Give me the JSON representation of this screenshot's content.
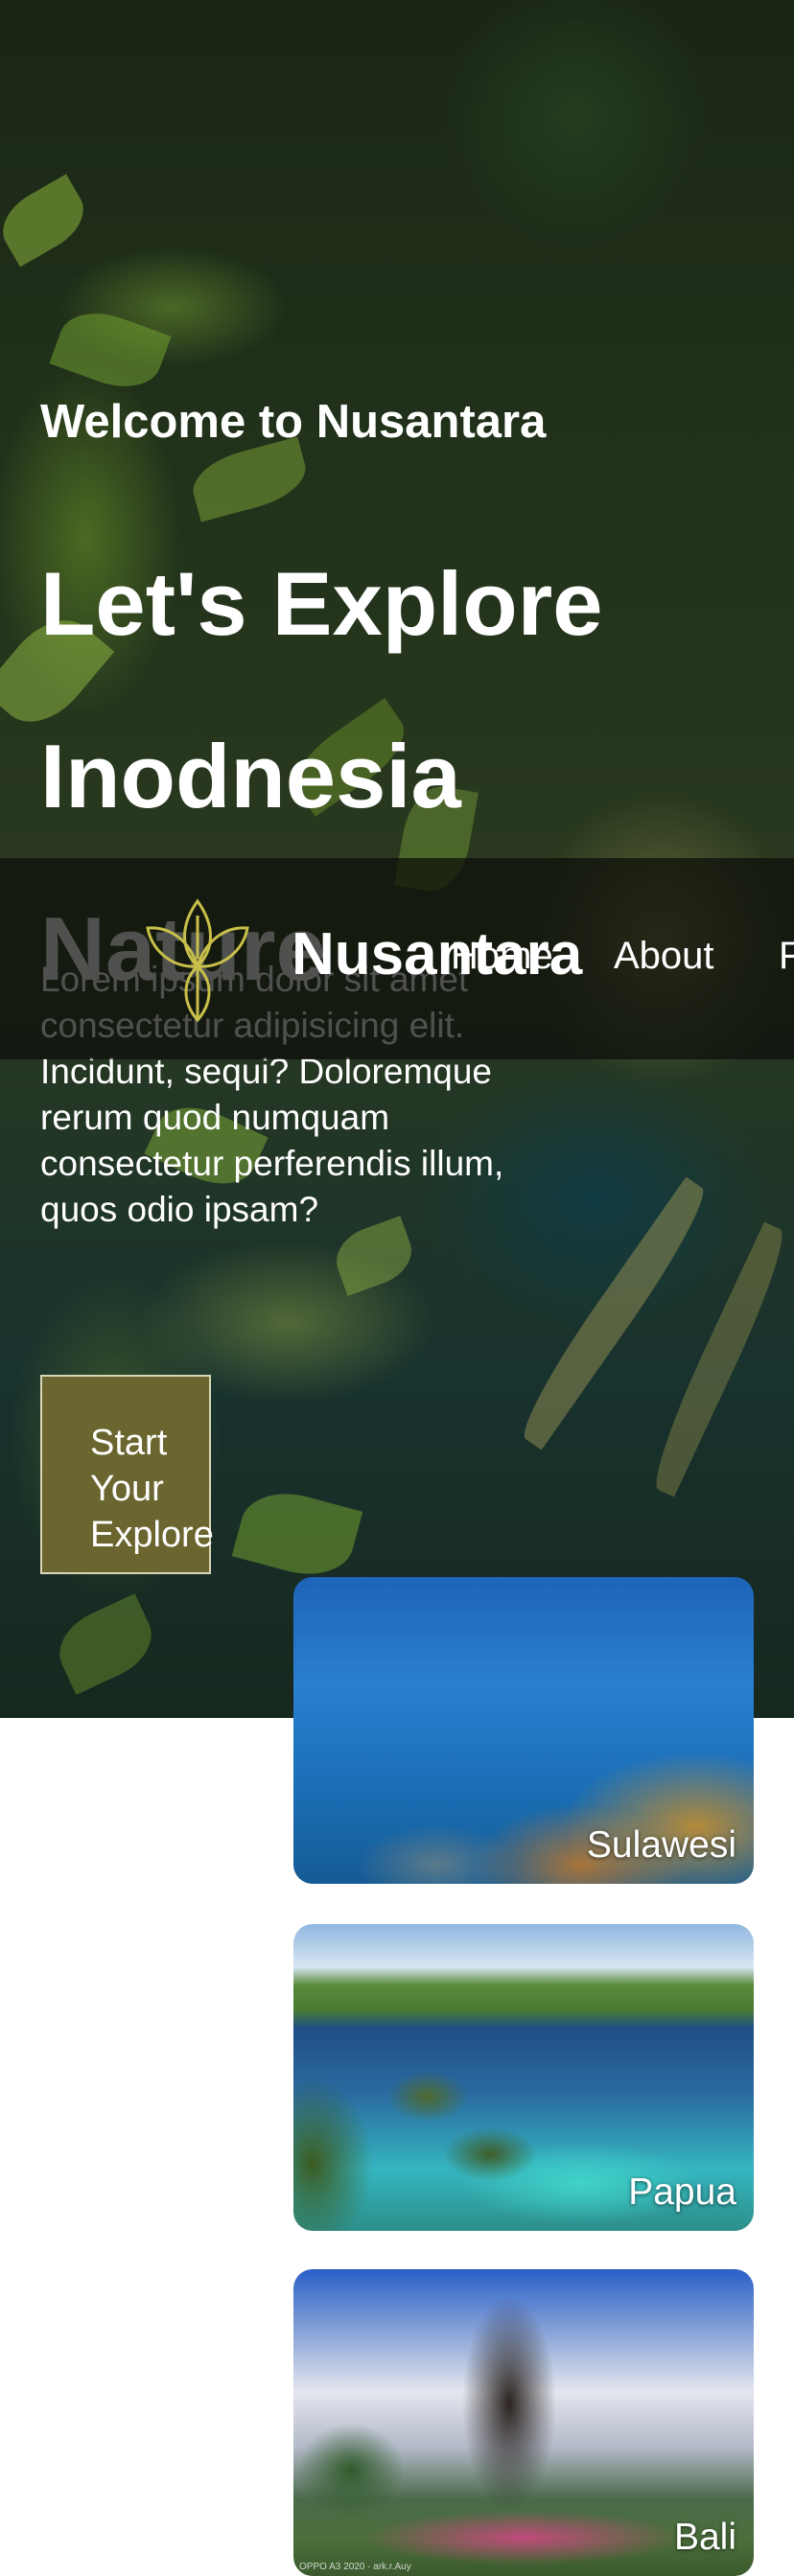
{
  "hero": {
    "welcome": "Welcome to Nusantara",
    "headline": "Let's Explore Inodnesia Nature",
    "body": "Lorem ipsum dolor sit amet consectetur adipisicing elit. Incidunt, sequi? Doloremque rerum quod numquam consectetur perferendis illum, quos odio ipsam?",
    "cta_label": "Start Your Explore"
  },
  "navbar": {
    "brand": "Nusantara",
    "logo_icon": "lotus-icon",
    "items": [
      {
        "label": "Home"
      },
      {
        "label": "About"
      },
      {
        "label": "F"
      }
    ]
  },
  "destinations": [
    {
      "label": "Sulawesi"
    },
    {
      "label": "Papua"
    },
    {
      "label": "Bali",
      "watermark": "OPPO A3 2020 · ark.r.Auy"
    }
  ],
  "colors": {
    "cta_background": "#6b6530",
    "cta_border": "#d9d6b8",
    "logo_stroke": "#c8c04a",
    "navbar_overlay": "rgba(12,14,10,0.72)"
  }
}
